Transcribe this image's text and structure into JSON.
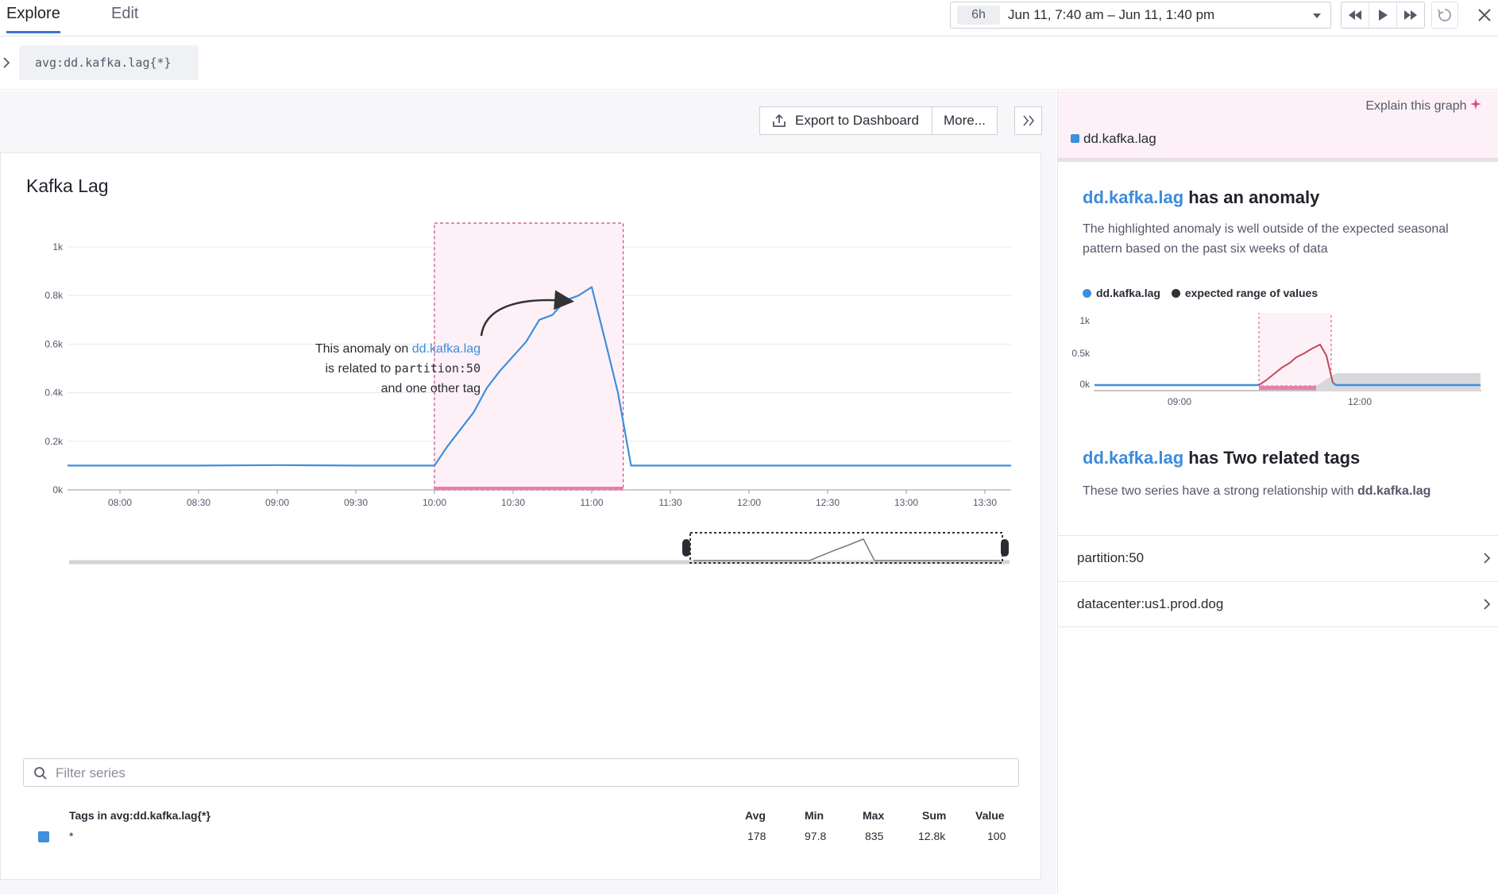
{
  "tabs": [
    "Explore",
    "Edit"
  ],
  "timepicker": {
    "badge": "6h",
    "range": "Jun 11, 7:40 am – Jun 11, 1:40 pm"
  },
  "query": {
    "text": "avg:dd.kafka.lag{*}"
  },
  "toolbar": {
    "export_label": "Export to Dashboard",
    "more_label": "More..."
  },
  "graph": {
    "title": "Kafka Lag",
    "annotation": {
      "line1_prefix": "This anomaly on ",
      "line1_metric": "dd.kafka.lag",
      "line2_prefix": "is related to ",
      "line2_tag": "partition:50",
      "line3": "and one other tag"
    }
  },
  "chart_data": {
    "type": "line",
    "title": "Kafka Lag",
    "series": [
      {
        "name": "dd.kafka.lag",
        "color": "#3e8fdc",
        "x": [
          "07:40",
          "08:00",
          "08:30",
          "09:00",
          "09:30",
          "10:00",
          "10:05",
          "10:15",
          "10:20",
          "10:25",
          "10:30",
          "10:35",
          "10:40",
          "10:45",
          "10:50",
          "10:55",
          "11:00",
          "11:05",
          "11:10",
          "11:15",
          "11:30",
          "12:00",
          "12:30",
          "13:00",
          "13:30",
          "13:40"
        ],
        "y": [
          100,
          100,
          100,
          102,
          100,
          100,
          180,
          320,
          420,
          490,
          550,
          610,
          700,
          720,
          780,
          800,
          835,
          620,
          400,
          100,
          100,
          100,
          100,
          100,
          100,
          100
        ]
      }
    ],
    "x_ticks": [
      "08:00",
      "08:30",
      "09:00",
      "09:30",
      "10:00",
      "10:30",
      "11:00",
      "11:30",
      "12:00",
      "12:30",
      "13:00",
      "13:30"
    ],
    "y_ticks": [
      "0k",
      "0.2k",
      "0.4k",
      "0.6k",
      "0.8k",
      "1k"
    ],
    "ylim": [
      0,
      1000
    ],
    "anomaly_window": [
      "10:00",
      "11:12"
    ]
  },
  "filter": {
    "placeholder": "Filter series"
  },
  "table": {
    "headers": {
      "tags": "Tags in avg:dd.kafka.lag{*}",
      "avg": "Avg",
      "min": "Min",
      "max": "Max",
      "sum": "Sum",
      "value": "Value"
    },
    "rows": [
      {
        "tag": "*",
        "avg": "178",
        "min": "97.8",
        "max": "835",
        "sum": "12.8k",
        "value": "100"
      }
    ]
  },
  "panel": {
    "explain_label": "Explain this graph",
    "series_label": "dd.kafka.lag",
    "anomaly": {
      "metric": "dd.kafka.lag",
      "title_suffix": " has an anomaly",
      "description": "The highlighted anomaly is well outside of the expected seasonal pattern based on the past six weeks of data"
    },
    "legend": {
      "series": "dd.kafka.lag",
      "expected": "expected range of values"
    },
    "mini_chart": {
      "y_ticks": [
        "0k",
        "0.5k",
        "1k"
      ],
      "x_ticks": [
        "09:00",
        "12:00"
      ]
    },
    "related": {
      "metric": "dd.kafka.lag",
      "title_suffix": " has Two related tags",
      "description_prefix": "These two series have a strong relationship with ",
      "description_metric": "dd.kafka.lag"
    },
    "tags": [
      "partition:50",
      "datacenter:us1.prod.dog"
    ]
  }
}
